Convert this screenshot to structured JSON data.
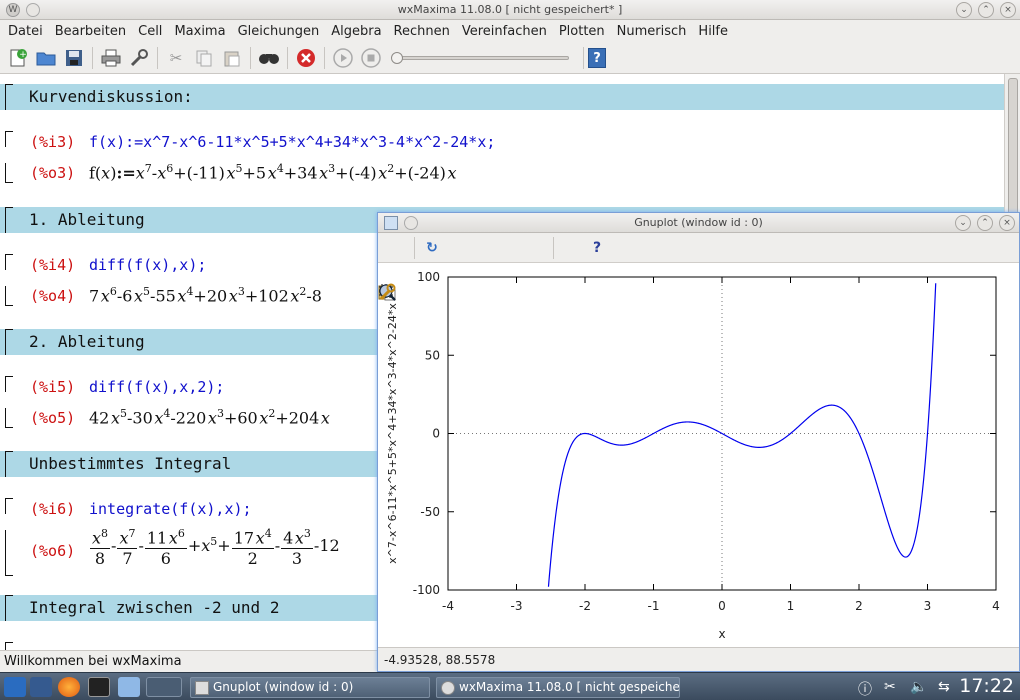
{
  "window": {
    "title": "wxMaxima 11.08.0 [ nicht gespeichert* ]"
  },
  "menu": [
    "Datei",
    "Bearbeiten",
    "Cell",
    "Maxima",
    "Gleichungen",
    "Algebra",
    "Rechnen",
    "Vereinfachen",
    "Plotten",
    "Numerisch",
    "Hilfe"
  ],
  "toolbar": {
    "icons": [
      "new-document-icon",
      "open-folder-icon",
      "save-icon",
      "print-icon",
      "preferences-icon",
      "cut-icon",
      "copy-icon",
      "paste-icon",
      "find-icon",
      "interrupt-icon",
      "play-icon",
      "stop-icon"
    ],
    "help_label": "?"
  },
  "cells": {
    "h1": "Kurvendiskussion:",
    "i3_label": "(%i3)",
    "i3_code": "f(x):=x^7-x^6-11*x^5+5*x^4+34*x^3-4*x^2-24*x;",
    "o3_label": "(%o3)",
    "h2": "1. Ableitung",
    "i4_label": "(%i4)",
    "i4_code": "diff(f(x),x);",
    "o4_label": "(%o4)",
    "h3": "2. Ableitung",
    "i5_label": "(%i5)",
    "i5_code": "diff(f(x),x,2);",
    "o5_label": "(%o5)",
    "h4": "Unbestimmtes Integral",
    "i6_label": "(%i6)",
    "i6_code": "integrate(f(x),x);",
    "o6_label": "(%o6)",
    "h5": "Integral zwischen -2 und 2"
  },
  "status": {
    "text": "Willkommen bei wxMaxima"
  },
  "gnuplot": {
    "title": "Gnuplot (window id : 0)",
    "toolbar_icons": [
      "copy-clipboard-icon",
      "replot-icon",
      "grid-icon",
      "zoom-previous-icon",
      "zoom-next-icon",
      "autoscale-icon",
      "config-icon",
      "help-icon"
    ],
    "status": "-4.93528,  88.5578"
  },
  "chart_data": {
    "type": "line",
    "function": "x^7-x^6-11*x^5+5*x^4+34*x^3-4*x^2-24*x",
    "xlabel": "x",
    "ylabel": "x^7-x^6-11*x^5+5*x^4+34*x^3-4*x^2-24*x",
    "xlim": [
      -4,
      4
    ],
    "ylim": [
      -100,
      100
    ],
    "xticks": [
      -4,
      -3,
      -2,
      -1,
      0,
      1,
      2,
      3,
      4
    ],
    "yticks": [
      -100,
      -50,
      0,
      50,
      100
    ],
    "color": "#0000ee",
    "series": [
      {
        "x": [
          -2.55,
          -2.5,
          -2.4,
          -2.3,
          -2.2,
          -2.1,
          -2.0,
          -1.9,
          -1.8,
          -1.7,
          -1.6,
          -1.5,
          -1.4,
          -1.3,
          -1.2,
          -1.1,
          -1.0,
          -0.8,
          -0.6,
          -0.5,
          -0.4,
          -0.2,
          0.0,
          0.2,
          0.4,
          0.6,
          0.8,
          1.0,
          1.2,
          1.4,
          1.6,
          1.8,
          2.0,
          2.2,
          2.4,
          2.5,
          2.6,
          2.7,
          2.8,
          2.9,
          3.0,
          3.1
        ],
        "y": [
          -100,
          -73.8,
          -37.0,
          -15.2,
          -4.1,
          -0.1,
          0,
          -1.8,
          -4.2,
          -6.2,
          -7.3,
          -7.5,
          -6.8,
          -5.1,
          -3.0,
          -0.9,
          1.0,
          4.2,
          6.2,
          6.6,
          6.5,
          4.5,
          0,
          -5.2,
          -8.5,
          -7.8,
          -3.0,
          5.0,
          13.0,
          17.6,
          15.9,
          6.1,
          -16,
          -47.0,
          -74.5,
          -78.1,
          -78.2,
          -59.4,
          -25.6,
          20.5,
          48,
          96
        ]
      }
    ]
  },
  "taskbar": {
    "tasks": [
      "Gnuplot (window id : 0)",
      "wxMaxima 11.08.0 [ nicht gespeichert* ]"
    ],
    "clock": "17:22"
  }
}
